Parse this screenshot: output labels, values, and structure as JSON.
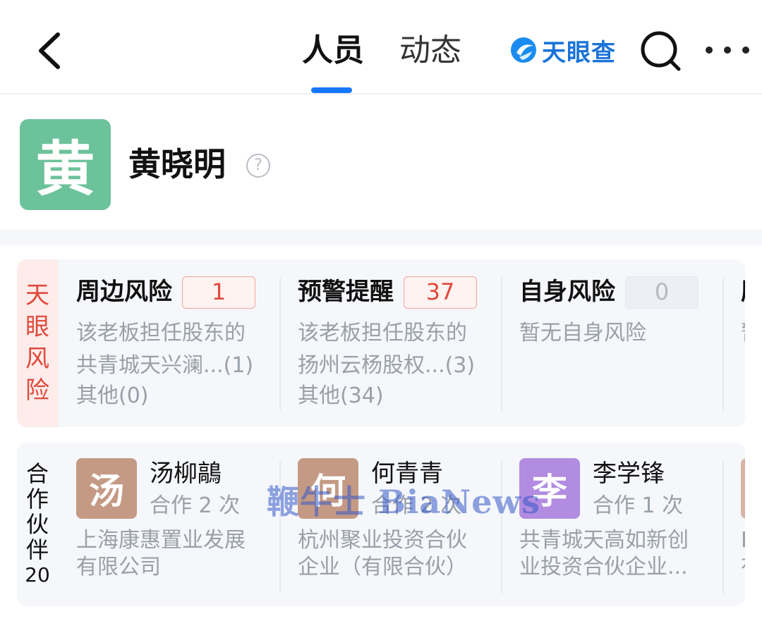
{
  "header": {
    "tabs": [
      {
        "label": "人员",
        "active": true
      },
      {
        "label": "动态",
        "active": false
      }
    ],
    "logo_text": "天眼查",
    "accent_color": "#1677ff"
  },
  "profile": {
    "avatar_char": "黄",
    "name": "黄晓明",
    "help_icon": "question-circle-icon"
  },
  "risk_section": {
    "label": "天眼风险",
    "items": [
      {
        "title": "周边风险",
        "count": "1",
        "line1": "该老板担任股东的",
        "line2": "共青城天兴澜...(1)",
        "other": "其他(0)"
      },
      {
        "title": "预警提醒",
        "count": "37",
        "line1": "该老板担任股东的",
        "line2": "扬州云杨股权...(3)",
        "other": "其他(34)"
      },
      {
        "title": "自身风险",
        "count": "0",
        "line1": "",
        "line2": "暂无自身风险",
        "other": ""
      },
      {
        "title": "历",
        "count": "",
        "line1": "",
        "line2": "暂",
        "other": ""
      }
    ]
  },
  "partners_section": {
    "label": "合作伙伴",
    "count": "20",
    "items": [
      {
        "avatar_char": "汤",
        "name": "汤柳鶮",
        "collab": "合作 2 次",
        "company_line1": "上海康惠置业发展",
        "company_line2": "有限公司",
        "avatar_color": "#c49a85"
      },
      {
        "avatar_char": "何",
        "name": "何青青",
        "collab": "合作 2 次",
        "company_line1": "杭州聚业投资合伙",
        "company_line2": "企业（有限合伙）",
        "avatar_color": "#c49a85"
      },
      {
        "avatar_char": "李",
        "name": "李学锋",
        "collab": "合作 1 次",
        "company_line1": "共青城天高如新创",
        "company_line2": "业投资合伙企业...",
        "avatar_color": "#b28ce0"
      },
      {
        "avatar_char": "",
        "name": "",
        "collab": "",
        "company_line1": "E",
        "company_line2": "有",
        "avatar_color": "#d6b4a4"
      }
    ]
  },
  "watermark": "鞭牛士 BiaNews"
}
